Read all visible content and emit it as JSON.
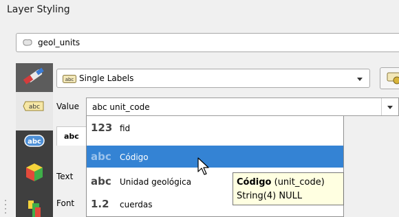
{
  "panel": {
    "title": "Layer Styling"
  },
  "layer_selector": {
    "value": "geol_units",
    "icon": "polygon-layer-icon"
  },
  "label_mode": {
    "value": "Single Labels",
    "icon": "abc-label-icon"
  },
  "value_field": {
    "label": "Value",
    "type_prefix": "abc",
    "value": "unit_code"
  },
  "side_tabs": {
    "text": "Text",
    "font": "Font",
    "tab_abc": "abc"
  },
  "field_list": {
    "items": [
      {
        "type_icon": "123",
        "name": "fid"
      },
      {
        "type_icon": "abc",
        "name": "Código"
      },
      {
        "type_icon": "abc",
        "name": "Unidad geológica"
      },
      {
        "type_icon": "1.2",
        "name": "cuerdas"
      }
    ],
    "selected_index": 1
  },
  "tooltip": {
    "title": "Código",
    "field_ref": "(unit_code)",
    "type": "String(4) NULL"
  },
  "colors": {
    "selection": "#3483d4",
    "tooltip_bg": "#ffffe1",
    "toolbar_dark": "#3f3f3f"
  }
}
